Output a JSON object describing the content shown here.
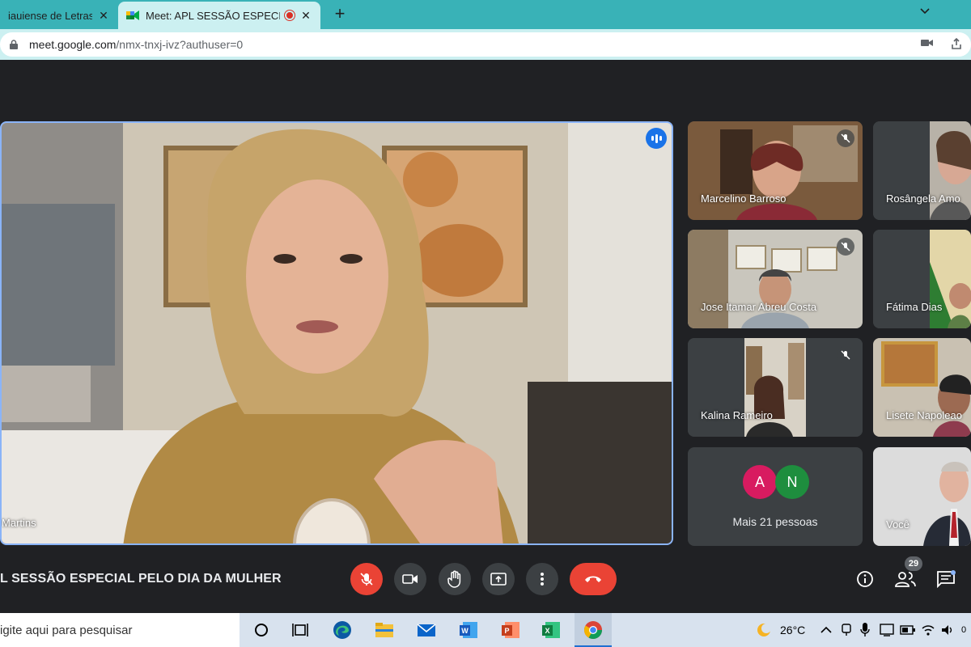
{
  "browser": {
    "tabs": [
      {
        "title": "iauiense de Letras: ag"
      },
      {
        "title": "Meet: APL SESSÃO ESPECIAL"
      }
    ],
    "url_host": "meet.google.com",
    "url_path": "/nmx-tnxj-ivz?authuser=0"
  },
  "meeting": {
    "title": "L SESSÃO ESPECIAL PELO DIA DA MULHER",
    "main_speaker": "Martins",
    "participant_count": "29",
    "participants": [
      {
        "name": "Marcelino Barroso"
      },
      {
        "name": "Rosângela Amo"
      },
      {
        "name": "Jose Itamar Abreu Costa"
      },
      {
        "name": "Fátima Dias"
      },
      {
        "name": "Kalina Rameiro"
      },
      {
        "name": "Lisete Napoleao"
      },
      {
        "name": "Você"
      }
    ],
    "more": {
      "avatars": [
        {
          "letter": "A",
          "color": "#d81b60"
        },
        {
          "letter": "N",
          "color": "#1e8e3e"
        }
      ],
      "label": "Mais 21 pessoas"
    }
  },
  "taskbar": {
    "search_placeholder": "igite aqui para pesquisar",
    "temperature": "26°C",
    "clock_fragment": "0"
  },
  "colors": {
    "tab_strip": "#39b2b7",
    "tab_active": "#ccf0f1",
    "meet_bg": "#202124",
    "control_bg": "#3c4043",
    "danger": "#ea4335",
    "speaking": "#1a73e8"
  }
}
